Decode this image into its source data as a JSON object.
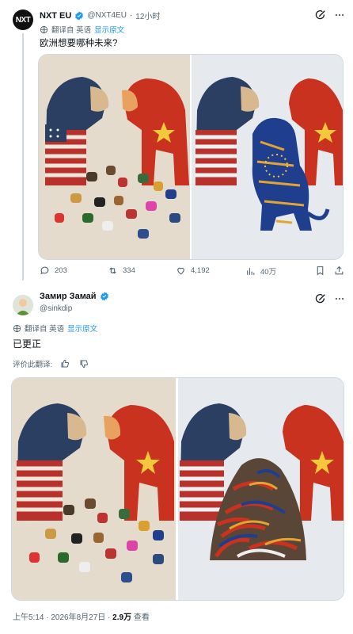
{
  "tweet1": {
    "author_name": "NXT EU",
    "handle": "@NXT4EU",
    "time": "12小时",
    "avatar_text": "NXT",
    "translate_label": "翻译自 英语",
    "show_original": "显示原文",
    "text": "欧洲想要哪种未来?",
    "stats": {
      "replies": "203",
      "retweets": "334",
      "likes": "4,192",
      "views": "40万"
    }
  },
  "tweet2": {
    "author_name": "Замир Замай",
    "handle": "@sinkdip",
    "translate_label": "翻译自 英语",
    "show_original": "显示原文",
    "text": "已更正",
    "rate_label": "评价此翻译:",
    "timestamp": "上午5:14 · 2026年8月27日 · ",
    "view_count": "2.9万",
    "view_label": " 查看"
  },
  "colors": {
    "accent": "#1d9bf0",
    "muted": "#536471",
    "us_blue": "#2b3f63",
    "us_red": "#b8322b",
    "china_red": "#c8321e",
    "eu_blue": "#1f3f8e",
    "gold": "#e2a532",
    "beige": "#e6ddd0",
    "grey_bg": "#e8ebee"
  },
  "icons": [
    "grok-icon",
    "more-icon",
    "translate-icon",
    "reply-icon",
    "retweet-icon",
    "like-icon",
    "views-icon",
    "bookmark-icon",
    "share-icon",
    "thumbs-up-icon",
    "thumbs-down-icon",
    "verified-icon"
  ]
}
